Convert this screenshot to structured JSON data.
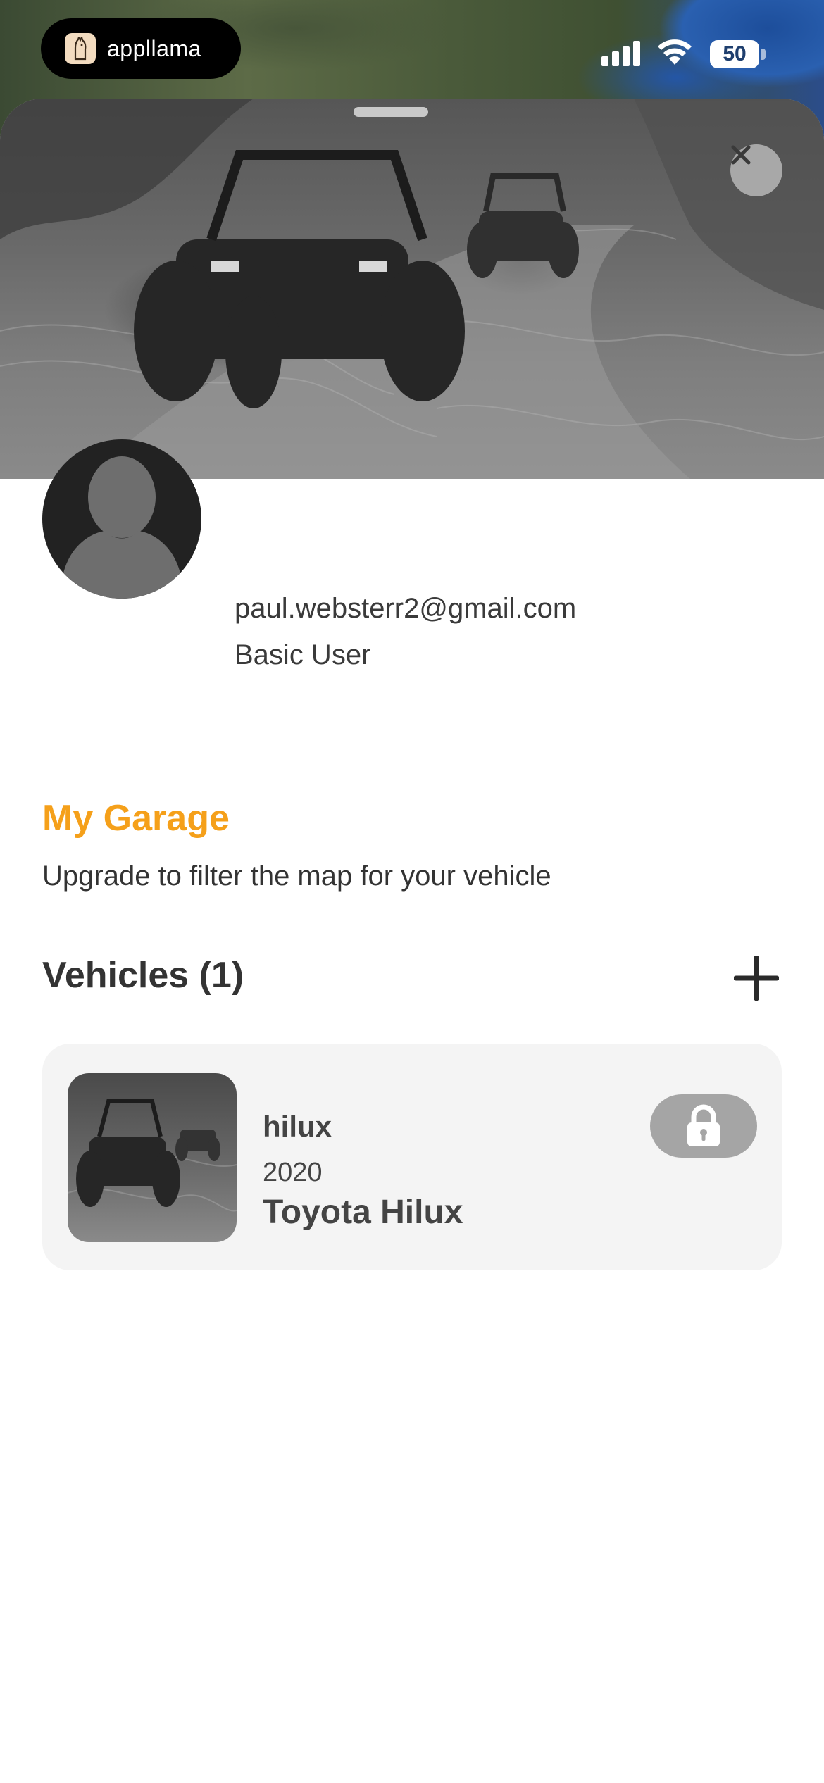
{
  "status_bar": {
    "brand_name": "appllama",
    "battery_level": "50",
    "icons": [
      "cellular-signal-icon",
      "wifi-icon",
      "battery-icon"
    ]
  },
  "hero": {
    "image": "off-road-buggies-photo",
    "close_icon": "close-icon"
  },
  "profile": {
    "email": "paul.websterr2@gmail.com",
    "user_type": "Basic User",
    "avatar_icon": "person-icon"
  },
  "garage": {
    "title": "My Garage",
    "subtitle": "Upgrade to filter the map for your vehicle",
    "vehicles_heading": "Vehicles (1)",
    "add_icon": "plus-icon",
    "vehicles": [
      {
        "nickname": "hilux",
        "year": "2020",
        "model": "Toyota Hilux",
        "lock_icon": "lock-icon"
      }
    ]
  },
  "colors": {
    "accent": "#f5a01a",
    "text": "#333333",
    "card_bg": "#f4f4f4",
    "lock_bg": "#a5a5a5"
  }
}
